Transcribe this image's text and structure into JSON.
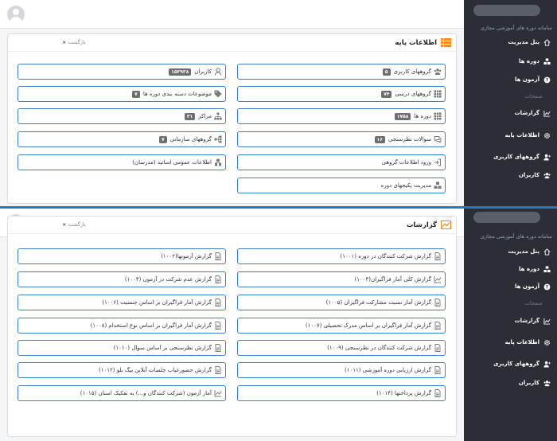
{
  "app": {
    "system_name": "سامانه دوره های آموزشی مجازی"
  },
  "sidebar": {
    "items": [
      {
        "label": "پنل مدیریت",
        "icon": "home-icon"
      },
      {
        "label": "دوره ها",
        "icon": "cubes-icon"
      },
      {
        "label": "آزمون ها",
        "icon": "question-circle-icon"
      },
      {
        "label": "صفحات",
        "icon": "pages-icon"
      },
      {
        "label": "گزارشات",
        "icon": "chart-line-icon"
      },
      {
        "label": "اطلاعات پایه",
        "icon": "gear-icon"
      },
      {
        "label": "گروههای کاربری",
        "icon": "user-group-icon"
      },
      {
        "label": "کاربران",
        "icon": "users-icon"
      }
    ]
  },
  "base_info": {
    "title": "اطلاعات پایه",
    "back_label": "بازگشت",
    "close_symbol": "×",
    "right_col": [
      {
        "label": "گروههای کاربری",
        "badge": "۵",
        "icon": "users-icon"
      },
      {
        "label": "گروههای درسی",
        "badge": "۷۴",
        "icon": "grid-icon"
      },
      {
        "label": "دوره ها",
        "badge": "۱۷۵۸",
        "icon": "grid-icon"
      },
      {
        "label": "سوالات نظرسنجی",
        "badge": "۱۶",
        "icon": "comments-icon"
      },
      {
        "label": "ورود اطلاعات گروهی",
        "badge": "",
        "icon": "sign-in-icon"
      },
      {
        "label": "مدیریت پکیجهای دوره",
        "badge": "",
        "icon": "cubes-icon"
      }
    ],
    "left_col": [
      {
        "label": "کاربران",
        "badge": "۱۵۳۹۳۸",
        "icon": "user-icon"
      },
      {
        "label": "موضوعات دسته بندی دوره ها",
        "badge": "۷",
        "icon": "tags-icon"
      },
      {
        "label": "مراکز",
        "badge": "۳۱",
        "icon": "sitemap-icon"
      },
      {
        "label": "گروههای سازمانی",
        "badge": "۷",
        "icon": "org-icon"
      },
      {
        "label": "اطلاعات عمومی اساتید (مدرسان)",
        "badge": "",
        "icon": "teacher-icon"
      }
    ]
  },
  "reports": {
    "title": "گزارشات",
    "back_label": "بازگشت",
    "close_symbol": "×",
    "right_col": [
      {
        "label": "گزارش شرکت کنندگان در دوره (۱۰۰۱)",
        "icon": "file-icon"
      },
      {
        "label": "گزارش کلی آمار فراگیران(۱۰۰۳)",
        "icon": "chart-line-icon"
      },
      {
        "label": "گزارش آمار نسبت مشارکت فراگیران (۱۰۰۵)",
        "icon": "file-icon"
      },
      {
        "label": "گزارش آمار فراگیران بر اساس مدرک تحصیلی (۱۰۰۷)",
        "icon": "file-icon"
      },
      {
        "label": "گزارش شرکت کنندگان در نظرسنجی (۱۰۰۹)",
        "icon": "file-icon"
      },
      {
        "label": "گزارش ارزیابی دوره آموزشی (۱۰۱۱)",
        "icon": "file-icon"
      },
      {
        "label": "گزارش پرداختها (۱۰۱۴)",
        "icon": "file-icon"
      }
    ],
    "left_col": [
      {
        "label": "گزارش آزمونها(۱۰۰۲)",
        "icon": "file-icon"
      },
      {
        "label": "گزارش عدم شرکت در آزمون (۱۰۰۴)",
        "icon": "file-icon"
      },
      {
        "label": "گزارش آمار فراگیران بر اساس جنسیت (۱۰۰۶)",
        "icon": "file-icon"
      },
      {
        "label": "گزارش آمار فراگیران بر اساس نوع استخدام (۱۰۰۸)",
        "icon": "file-icon"
      },
      {
        "label": "گزارش نظرسنجی بر اساس سوال (۱۰۱۰)",
        "icon": "file-icon"
      },
      {
        "label": "گزارش حضورغیاب جلسات آنلاین بیگ بلو (۱۰۱۲)",
        "icon": "file-icon"
      },
      {
        "label": "آمار آزمون (شرکت کنندگان و...) به تفکیک استان (۱۰۱۵)",
        "icon": "chart-line-icon"
      }
    ]
  },
  "colors": {
    "accent_blue": "#3a7fd1",
    "title_icon_orange": "#f28c28",
    "sidebar_bg": "#2b2e35"
  }
}
